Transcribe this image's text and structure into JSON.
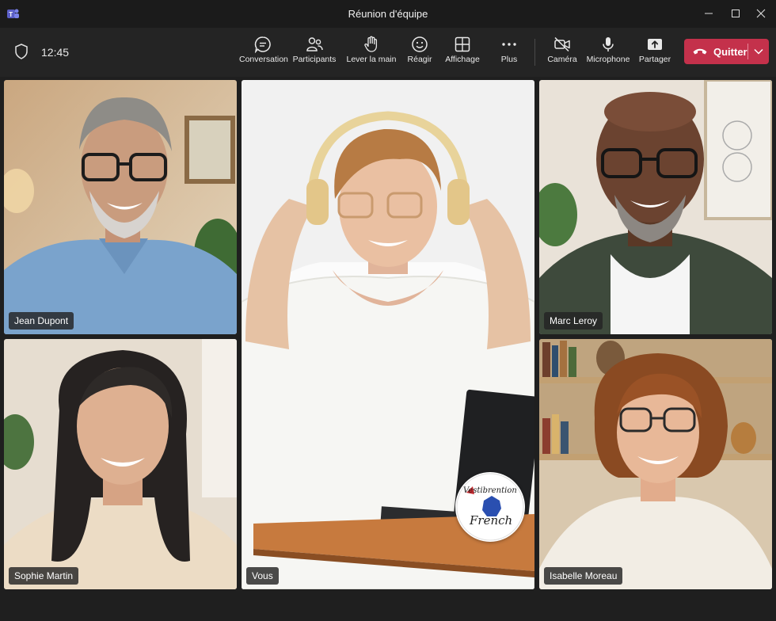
{
  "window": {
    "title": "Réunion d'équipe",
    "icons": {
      "app": "teams-icon",
      "minimize": "minimize-icon",
      "maximize": "maximize-icon",
      "close": "close-icon"
    }
  },
  "toolbar": {
    "security_icon": "shield-icon",
    "clock": "12:45",
    "buttons": [
      {
        "label": "Conversation",
        "icon": "chat-icon"
      },
      {
        "label": "Participants",
        "icon": "people-icon"
      },
      {
        "label": "Lever la main",
        "icon": "raise-hand-icon"
      },
      {
        "label": "Réagir",
        "icon": "smiley-icon"
      },
      {
        "label": "Affichage",
        "icon": "grid-view-icon"
      },
      {
        "label": "Plus",
        "icon": "more-dots-icon"
      },
      {
        "label": "Caméra",
        "icon": "camera-off-icon"
      },
      {
        "label": "Microphone",
        "icon": "microphone-icon"
      },
      {
        "label": "Partager",
        "icon": "share-screen-icon"
      }
    ],
    "leave": {
      "label": "Quitter",
      "icon": "hang-up-icon",
      "dropdown_icon": "chevron-down-icon",
      "color": "#c4314b"
    }
  },
  "participants": [
    {
      "name": "Jean Dupont"
    },
    {
      "name": "Vous"
    },
    {
      "name": "Marc Leroy"
    },
    {
      "name": "Sophie Martin"
    },
    {
      "name": "Isabelle Moreau"
    }
  ],
  "badge": {
    "line1": "Vestibrention",
    "line2": "French"
  },
  "colors": {
    "background": "#1f1f1f",
    "toolbar": "#242424",
    "leave": "#c4314b"
  }
}
